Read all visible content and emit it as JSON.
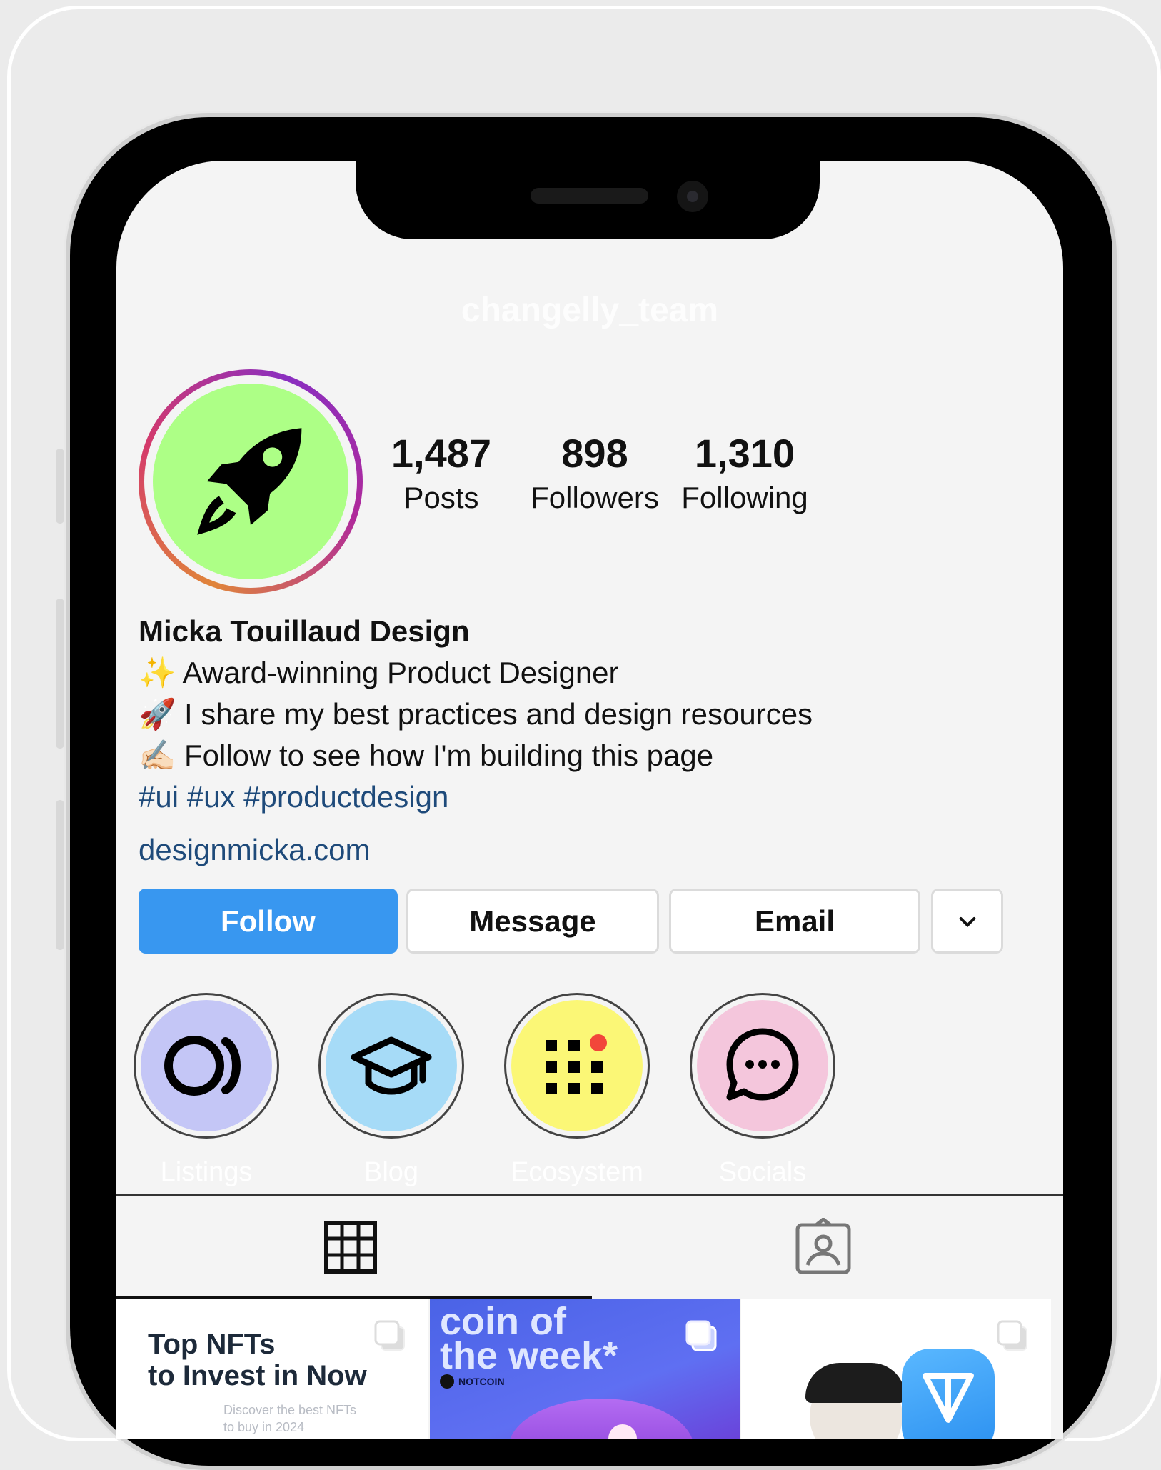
{
  "header": {
    "username": "changelly_team"
  },
  "stats": [
    {
      "value": "1,487",
      "label": "Posts"
    },
    {
      "value": "898",
      "label": "Followers"
    },
    {
      "value": "1,310",
      "label": "Following"
    }
  ],
  "bio": {
    "name": "Micka Touillaud Design",
    "lines": [
      {
        "emoji": "✨",
        "text": "Award-winning Product Designer"
      },
      {
        "emoji": "🚀",
        "text": "I share my best practices and design resources"
      },
      {
        "emoji": "✍🏻",
        "text": "Follow to see how I'm building this page"
      }
    ],
    "hashtags": "#ui #ux #productdesign",
    "link": "designmicka.com"
  },
  "actions": {
    "follow": "Follow",
    "message": "Message",
    "email": "Email",
    "more_icon": "chevron-down-icon"
  },
  "highlights": [
    {
      "label": "Listings",
      "icon": "listings-icon",
      "color": "#c4c6f6"
    },
    {
      "label": "Blog",
      "icon": "graduation-cap-icon",
      "color": "#a6dbf7"
    },
    {
      "label": "Ecosystem",
      "icon": "grid-dots-icon",
      "color": "#fbf776"
    },
    {
      "label": "Socials",
      "icon": "chat-bubble-icon",
      "color": "#f4c6dc"
    }
  ],
  "tabs": [
    {
      "name": "grid",
      "icon": "grid-icon",
      "active": true
    },
    {
      "name": "tagged",
      "icon": "tagged-user-icon",
      "active": false
    }
  ],
  "posts": [
    {
      "title_line1": "Top NFTs",
      "title_line2": "to Invest in Now",
      "sub_line1": "Discover the best NFTs",
      "sub_line2": "to buy in 2024"
    },
    {
      "title_line1": "coin of",
      "title_line2": "the week*",
      "brand": "NOTCOIN"
    },
    {
      "image": "ton-portrait"
    }
  ],
  "colors": {
    "follow": "#3897f0",
    "avatar_bg": "#adff86",
    "link": "#1e4a7a"
  }
}
